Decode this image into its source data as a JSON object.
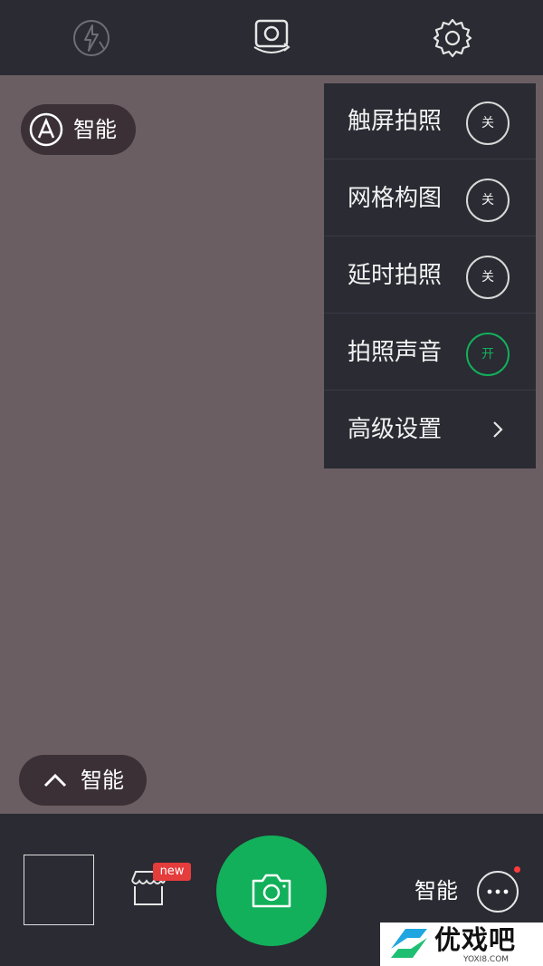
{
  "top_bar": {
    "icons": [
      "flash-auto-icon",
      "switch-camera-icon",
      "settings-gear-icon"
    ]
  },
  "mode_pill": {
    "icon": "auto-mode-icon",
    "label": "智能"
  },
  "settings_menu": {
    "items": [
      {
        "label": "触屏拍照",
        "state": "关"
      },
      {
        "label": "网格构图",
        "state": "关"
      },
      {
        "label": "延时拍照",
        "state": "关"
      },
      {
        "label": "拍照声音",
        "state": "开"
      },
      {
        "label": "高级设置",
        "state": ""
      }
    ]
  },
  "scene_pill": {
    "icon": "chevron-up-icon",
    "label": "智能"
  },
  "bottom_bar": {
    "badge_text": "new",
    "smart_label": "智能",
    "icons": [
      "gallery-thumbnail",
      "store-icon",
      "camera-shutter-icon",
      "more-icon"
    ]
  },
  "watermark": {
    "title": "优戏吧",
    "subtitle": "YOXI8.COM"
  },
  "colors": {
    "bar_bg": "#2a2b33",
    "preview_bg": "#6b5e63",
    "accent_green": "#12b05a",
    "badge_red": "#e53c3c"
  }
}
